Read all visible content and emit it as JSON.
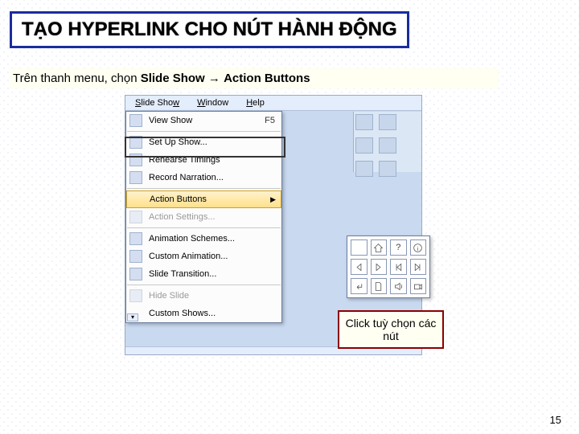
{
  "title": "TẠO HYPERLINK CHO NÚT HÀNH ĐỘNG",
  "instruction": {
    "pre": "Trên thanh menu, chọn ",
    "b1": "Slide Show",
    "arrow": " → ",
    "b2": "Action Buttons"
  },
  "menubar": {
    "slideShow": "Slide Show",
    "window": "Window",
    "help": "Help"
  },
  "menu": {
    "view": "View Show",
    "viewShort": "F5",
    "setup": "Set Up Show...",
    "rehearse": "Rehearse Timings",
    "record": "Record Narration...",
    "actionBtns": "Action Buttons",
    "actionSet": "Action Settings...",
    "schemes": "Animation Schemes...",
    "custAnim": "Custom Animation...",
    "slideTrans": "Slide Transition...",
    "hide": "Hide Slide",
    "custShows": "Custom Shows..."
  },
  "palette": {
    "icons": [
      "blank",
      "home",
      "help",
      "info",
      "back",
      "fwd",
      "first",
      "last",
      "return",
      "doc",
      "sound",
      "movie"
    ]
  },
  "callout": "Click tuỳ chọn các nút",
  "slidenum": "15"
}
